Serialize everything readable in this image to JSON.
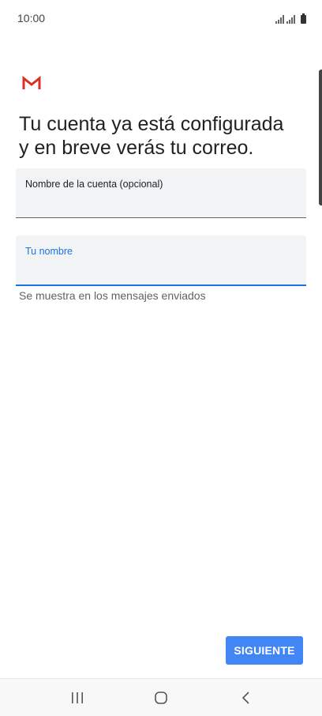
{
  "status_bar": {
    "time": "10:00"
  },
  "app": {
    "logo_icon": "gmail-logo-icon",
    "brand_color": "#d93025"
  },
  "title": {
    "line1": "Tu cuenta ya está configurada",
    "line2": "y en breve verás tu correo."
  },
  "account_name_field": {
    "label": "Nombre de la cuenta (opcional)",
    "value": ""
  },
  "your_name_field": {
    "label": "Tu nombre",
    "value": "",
    "helper": "Se muestra en los mensajes enviados"
  },
  "actions": {
    "next_label": "SIGUIENTE"
  },
  "colors": {
    "accent": "#1a73e8",
    "button": "#4285f4",
    "field_bg": "#f1f3f4"
  },
  "nav_bar": {
    "recents_icon": "recents-icon",
    "home_icon": "home-icon",
    "back_icon": "back-icon"
  }
}
